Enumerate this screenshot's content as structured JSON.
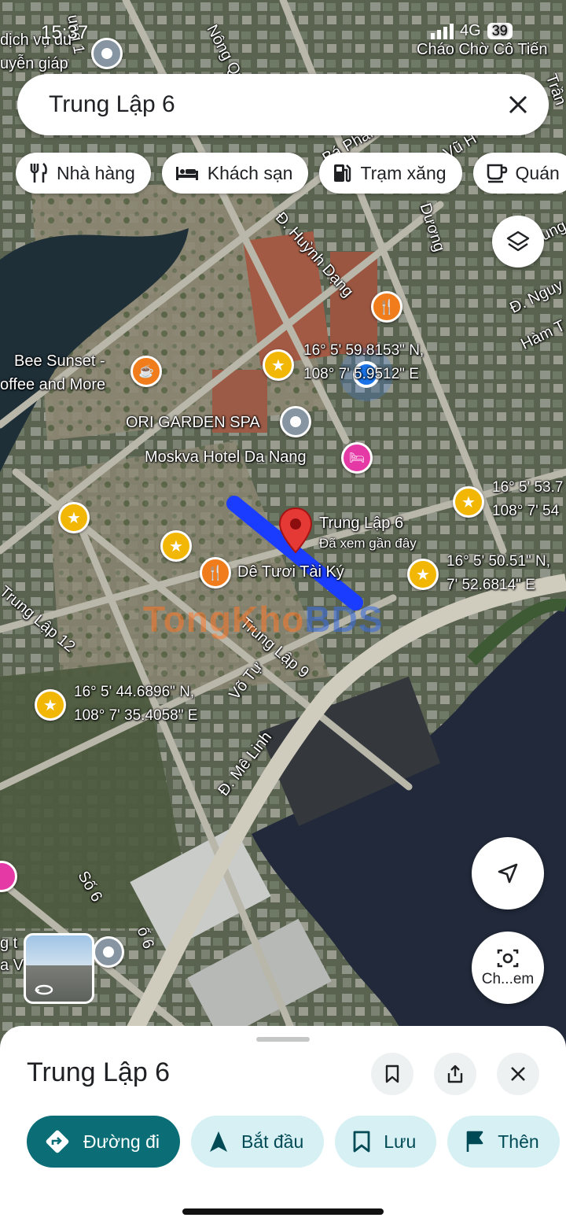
{
  "status_bar": {
    "time": "15:37",
    "network": "4G",
    "battery": "39"
  },
  "search": {
    "query": "Trung Lập 6",
    "clear_icon": "close-icon"
  },
  "category_chips": [
    {
      "label": "Nhà hàng",
      "icon": "restaurant-icon"
    },
    {
      "label": "Khách sạn",
      "icon": "hotel-icon"
    },
    {
      "label": "Trạm xăng",
      "icon": "gas-station-icon"
    },
    {
      "label": "Quán",
      "icon": "coffee-icon"
    }
  ],
  "map": {
    "street_labels": {
      "nong_quoc": "Nông Quốc",
      "huynh_dang": "Đ. Huỳnh Dạng",
      "duong": "Dương",
      "pha": "Bá Phan",
      "vu": "Vũ H",
      "nguy": "Đ. Nguy",
      "ham": "Hàm T",
      "trung_lap_12": "Trung Lập 12",
      "trung_lap_9": "Trung Lập 9",
      "vo_tu": "Võ Tự",
      "me_linh": "Đ. Mê Linh",
      "so_6": "Số 6",
      "so_6b": "ố 6",
      "tran": "Trần",
      "hung": "Hung",
      "ung": "ung 1"
    },
    "places": {
      "dich_vu_1": "dịch vụ du",
      "dich_vu_2": "uyễn giáp",
      "chao": "Cháo Chờ Cô Tiến",
      "bee_1": "Bee Sunset -",
      "bee_2": "offee and More",
      "ori": "ORI GARDEN SPA",
      "moskva": "Moskva Hotel Da Nang",
      "de_tuoi": "Dê Tươi Tài Ký",
      "left_1": "g t",
      "left_2": "a V"
    },
    "selected": {
      "name": "Trung Lập 6",
      "subtitle": "Đã xem gần đây"
    },
    "coordinates": {
      "c1_lat": "16° 5' 59.8153\" N,",
      "c1_lng": "108° 7' 5.9512\" E",
      "c2_lat": "16° 5' 53.7",
      "c2_lng": "108° 7' 54",
      "c3_lat": "16° 5' 50.51\" N,",
      "c3_lng": "7' 52.6814\" E",
      "c4_lat": "16° 5' 44.6896\" N,",
      "c4_lng": "108° 7' 35.4058\" E"
    },
    "watermark": {
      "part1": "TongKho",
      "part2": "BDS"
    },
    "street_view_icon": "street-view-icon",
    "layers_icon": "layers-icon",
    "location_icon": "navigation-arrow-icon",
    "lens_label": "Ch...em"
  },
  "sheet": {
    "title": "Trung Lập 6",
    "actions": [
      {
        "label": "Đường đi",
        "icon": "directions-icon"
      },
      {
        "label": "Bắt đầu",
        "icon": "navigation-icon"
      },
      {
        "label": "Lưu",
        "icon": "bookmark-icon"
      },
      {
        "label": "Thên",
        "icon": "flag-icon"
      }
    ]
  },
  "colors": {
    "primary": "#0b6e76",
    "tonal": "#d6f0f4",
    "route": "#1a3cff",
    "pin": "#e53935"
  }
}
